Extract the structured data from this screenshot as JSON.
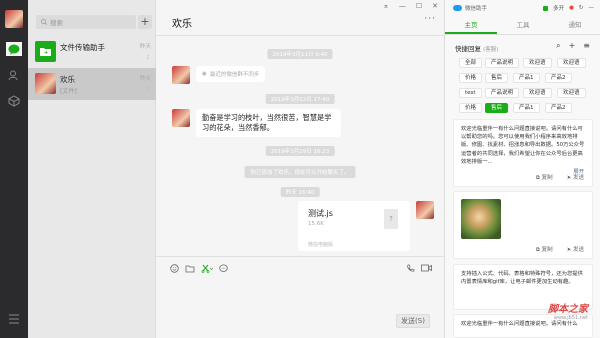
{
  "sidebar": {
    "icons": [
      "chat-icon",
      "contacts-icon",
      "favorites-icon",
      "menu-icon"
    ]
  },
  "search": {
    "placeholder": "搜索"
  },
  "sessions": [
    {
      "title": "文件传输助手",
      "sub": "",
      "time": "昨天"
    },
    {
      "title": "欢乐",
      "sub": "[文件]",
      "time": "昨天"
    }
  ],
  "chat": {
    "title": "欢乐",
    "more": "···",
    "timestamps": [
      "2019年3月11日 9:40",
      "2019年3月12日 17:40",
      "2019年3月29日 16:23",
      "昨天 16:40"
    ],
    "quote_text": "最近的微信群不同步",
    "message": "勤奋是学习的枝叶，当然很苦，智慧是学习的花朵，当然香郁。",
    "system_msg": "你已添加了欢乐，现在可以开始聊天了。",
    "file": {
      "name": "测试.js",
      "size": "15.6K",
      "source": "微信电脑版",
      "icon": "?"
    },
    "send_label": "发送(S)"
  },
  "assistant": {
    "app_name": "微信助手",
    "top_label": "多开",
    "tabs": [
      "主页",
      "工具",
      "通知"
    ],
    "quick_reply_title": "快捷回复",
    "quick_reply_sub": "(客服)",
    "tags": [
      [
        "全部",
        "产品说明",
        "欢迎语",
        "欢迎语"
      ],
      [
        "价格",
        "售后",
        "产品1",
        "产品2"
      ],
      [
        "test",
        "产品说明",
        "欢迎语",
        "欢迎语"
      ],
      [
        "价格",
        "售后",
        "产品1",
        "产品2"
      ]
    ],
    "card1_text": "欢迎光临重伴一有什么问题直接说吧。请问有什么可以帮助您的吗。您可以使用我们小程序来高效地排版、修图、找素材、招涨息和导出数据。50万公众号运营者的共同选择，我们希望让你在公众号后台更高效地排版一...",
    "expand": "展开",
    "copy": "复制",
    "send": "发送",
    "card3_text": "支持插入公式、代码、表格和特殊符号，还为您提供内置表情库和gif库，让电子邮件更加生动有趣。",
    "card4_text": "欢迎光临重伴一有什么问题直接说吧。请问有什么",
    "watermark": "脚本之家",
    "watermark_sub": "www.jb51.net"
  }
}
